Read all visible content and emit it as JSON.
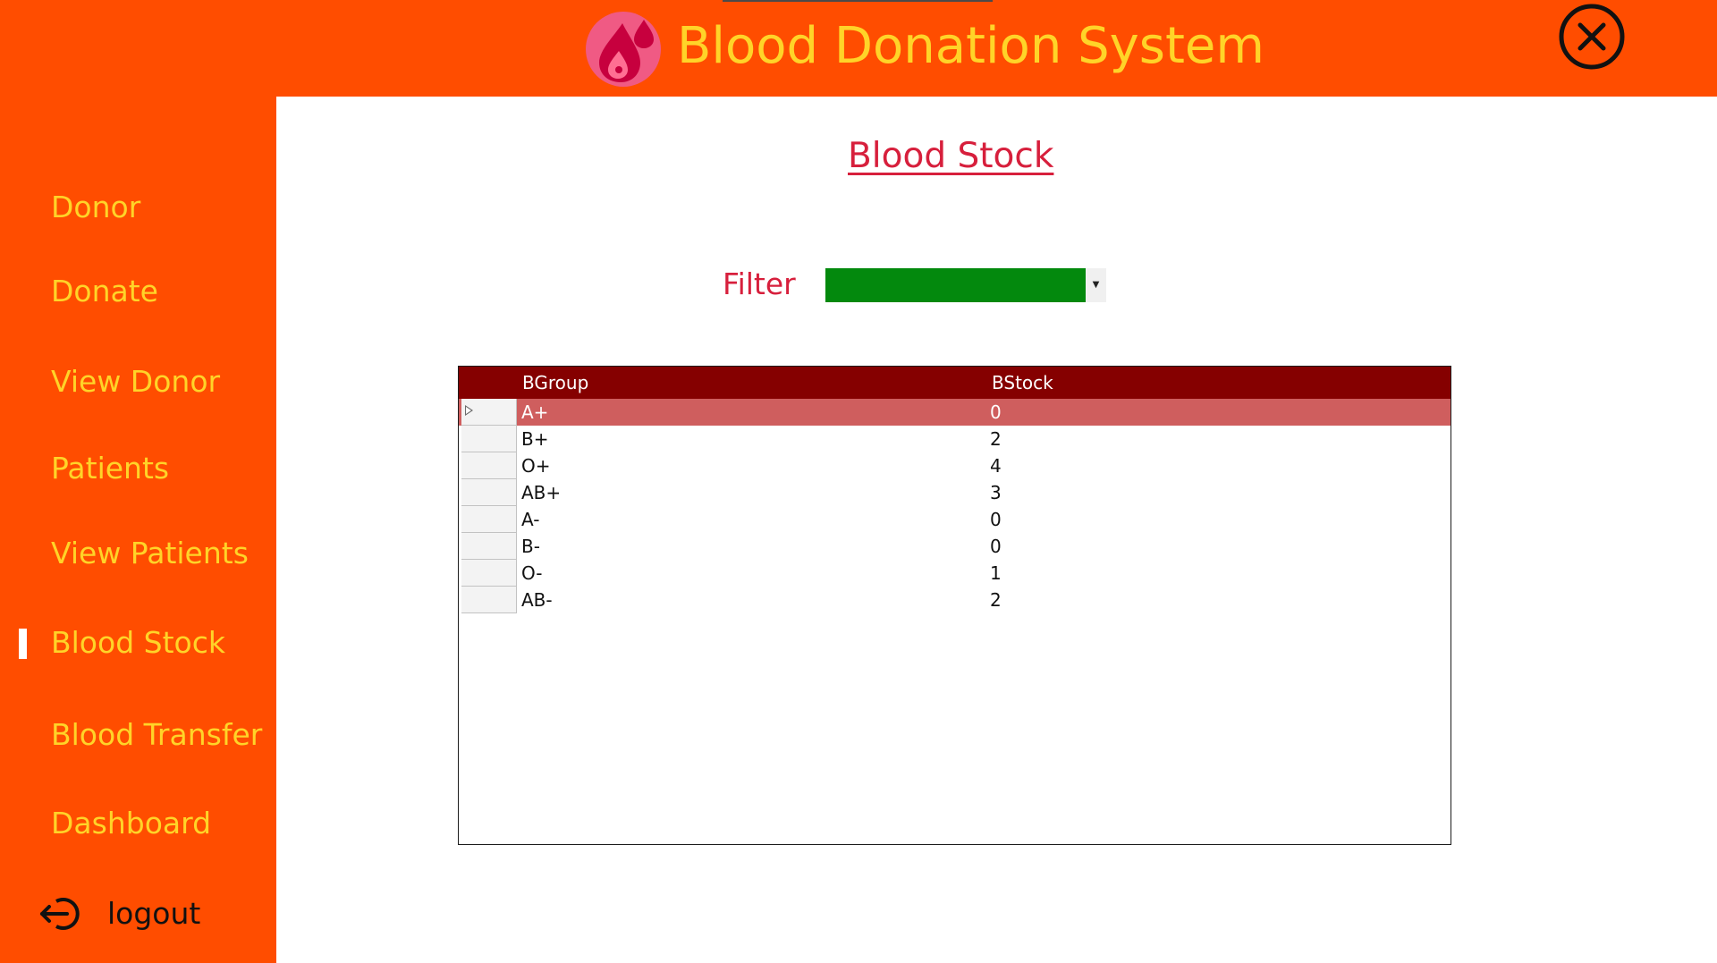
{
  "header": {
    "title": "Blood Donation System",
    "logo_icon": "blood-drop-logo-icon",
    "close_icon": "close-circle-icon"
  },
  "sidebar": {
    "items": [
      {
        "label": "Donor"
      },
      {
        "label": "Donate"
      },
      {
        "label": "View Donor"
      },
      {
        "label": "Patients"
      },
      {
        "label": "View Patients"
      },
      {
        "label": "Blood Stock",
        "active": true
      },
      {
        "label": "Blood Transfer"
      },
      {
        "label": "Dashboard"
      }
    ],
    "logout_label": "logout",
    "logout_icon": "logout-arrow-icon"
  },
  "main": {
    "title": "Blood Stock",
    "filter": {
      "label": "Filter",
      "value": ""
    },
    "grid": {
      "columns": [
        "BGroup",
        "BStock"
      ],
      "rows": [
        {
          "group": "A+",
          "stock": "0",
          "selected": true
        },
        {
          "group": "B+",
          "stock": "2"
        },
        {
          "group": "O+",
          "stock": "4"
        },
        {
          "group": "AB+",
          "stock": "3"
        },
        {
          "group": "A-",
          "stock": "0"
        },
        {
          "group": "B-",
          "stock": "0"
        },
        {
          "group": "O-",
          "stock": "1"
        },
        {
          "group": "AB-",
          "stock": "2"
        }
      ]
    }
  },
  "colors": {
    "primary_orange": "#ff4d00",
    "accent_yellow": "#ffd428",
    "title_red": "#d71f3c",
    "grid_header": "#850000",
    "selected_row": "#cf5e5e",
    "filter_green": "#03890d"
  }
}
